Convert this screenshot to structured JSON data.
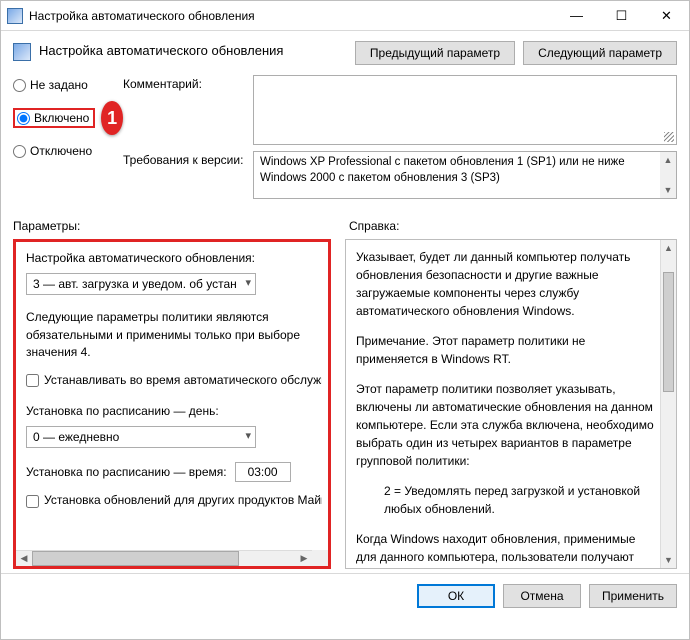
{
  "window": {
    "title": "Настройка автоматического обновления"
  },
  "header": {
    "title": "Настройка автоматического обновления",
    "prev": "Предыдущий параметр",
    "next": "Следующий параметр"
  },
  "state": {
    "not_configured": "Не задано",
    "enabled": "Включено",
    "disabled": "Отключено"
  },
  "callout": {
    "n1": "1"
  },
  "labels": {
    "comment": "Комментарий:",
    "requirements": "Требования к версии:",
    "parameters": "Параметры:",
    "help": "Справка:"
  },
  "requirements": {
    "text": "Windows XP Professional с пакетом обновления 1 (SP1) или не ниже Windows 2000 с пакетом обновления 3 (SP3)"
  },
  "params": {
    "heading": "Настройка автоматического обновления:",
    "mode_value": "3 — авт. загрузка и уведом. об устан",
    "note": "Следующие параметры политики являются обязательными и применимы только при выборе значения 4.",
    "chk_maint": "Устанавливать во время автоматического обслуживания",
    "day_label": "Установка по расписанию — день:",
    "day_value": "0 — ежедневно",
    "time_label": "Установка по расписанию — время:",
    "time_value": "03:00",
    "chk_other": "Установка обновлений для других продуктов Майкрософт"
  },
  "help": {
    "p1": "Указывает, будет ли данный компьютер получать обновления безопасности и другие важные загружаемые компоненты через службу автоматического обновления Windows.",
    "p2": "Примечание. Этот параметр политики не применяется в Windows RT.",
    "p3": "Этот параметр политики позволяет указывать, включены ли автоматические обновления на данном компьютере. Если эта служба включена, необходимо выбрать один из четырех вариантов в параметре групповой политики:",
    "p4": "2 = Уведомлять перед загрузкой и установкой любых обновлений.",
    "p5": "Когда Windows находит обновления, применимые для данного компьютера, пользователи получают уведомление о готовности обновлений к загрузке. После перехода в Центр обновления Windows пользователи могут загрузить и"
  },
  "buttons": {
    "ok": "ОК",
    "cancel": "Отмена",
    "apply": "Применить"
  }
}
